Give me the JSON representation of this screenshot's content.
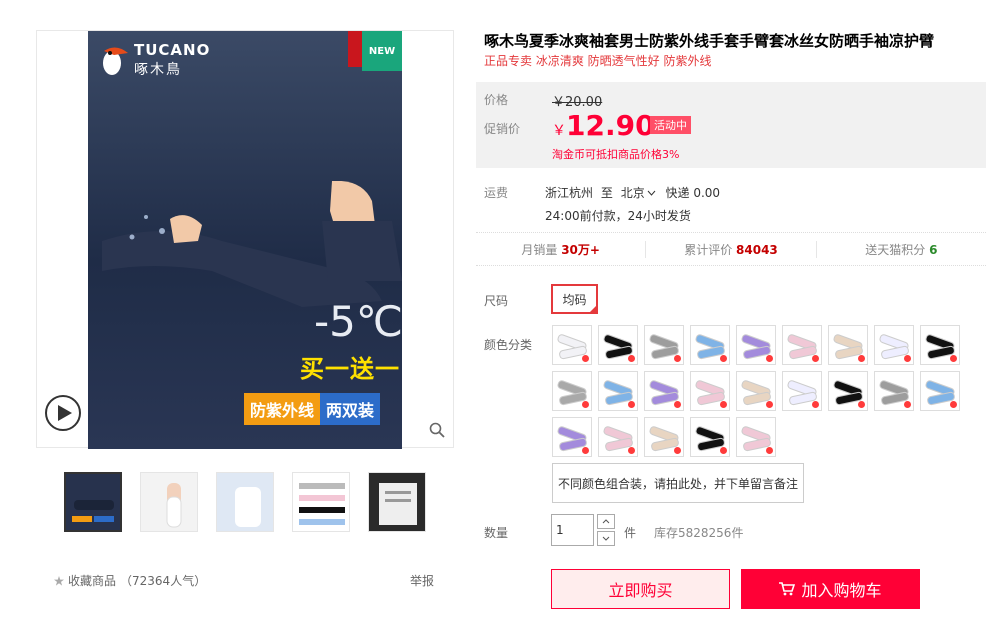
{
  "gallery": {
    "brand_en": "TUCANO",
    "brand_cn": "啄木鳥",
    "new_badge": "NEW",
    "temp_text": "-5℃",
    "promo_line1": "买一送一",
    "promo_tag_a": "防紫外线",
    "promo_tag_b": "两双装",
    "thumbnail_count": 5,
    "selected_thumbnail": 1
  },
  "footer": {
    "favorite_label": "收藏商品",
    "favorite_count": "（72364人气）",
    "report_label": "举报"
  },
  "product": {
    "title": "啄木鸟夏季冰爽袖套男士防紫外线手套手臂套冰丝女防晒手袖凉护臂",
    "subtitle": "正品专卖 冰凉清爽 防晒透气性好 防紫外线"
  },
  "price": {
    "price_label": "价格",
    "original_price": "￥20.00",
    "promo_label": "促销价",
    "currency": "￥",
    "promo_price": "12.90",
    "activity_tag": "活动中",
    "coin_note": "淘金币可抵扣商品价格3%"
  },
  "shipping": {
    "label": "运费",
    "from": "浙江杭州",
    "to_word": "至",
    "to": "北京",
    "method": "快递 0.00",
    "note": "24:00前付款，24小时发货"
  },
  "stats": {
    "monthly_label": "月销量",
    "monthly_value": "30万+",
    "reviews_label": "累计评价",
    "reviews_value": "84043",
    "points_label": "送天猫积分",
    "points_value": "6"
  },
  "options": {
    "size_label": "尺码",
    "size_value": "均码",
    "color_label": "颜色分类",
    "combo_note": "不同颜色组合装，请拍此处，并下单留言备注",
    "swatches": [
      {
        "color": "#f2f2f6"
      },
      {
        "color": "#111111"
      },
      {
        "color": "#9d9d9d"
      },
      {
        "color": "#7fb3e6"
      },
      {
        "color": "#a38bdc"
      },
      {
        "color": "#f0c8d6"
      },
      {
        "color": "#e8d5c2"
      },
      {
        "color": "#eeeeff"
      },
      {
        "color": "#111111"
      },
      {
        "color": "#a9a9a9"
      },
      {
        "color": "#7fb3e6"
      },
      {
        "color": "#a38bdc"
      },
      {
        "color": "#f0c8d6"
      },
      {
        "color": "#e8d5c2"
      },
      {
        "color": "#eeeeff"
      },
      {
        "color": "#111111"
      },
      {
        "color": "#9d9d9d"
      },
      {
        "color": "#7fb3e6"
      },
      {
        "color": "#a38bdc"
      },
      {
        "color": "#f0c8d6"
      },
      {
        "color": "#e8d5c2"
      },
      {
        "color": "#111111"
      },
      {
        "color": "#f0c8d6"
      }
    ]
  },
  "quantity": {
    "label": "数量",
    "value": "1",
    "unit": "件",
    "stock": "库存5828256件"
  },
  "actions": {
    "buy_now": "立即购买",
    "add_to_cart": "加入购物车"
  }
}
